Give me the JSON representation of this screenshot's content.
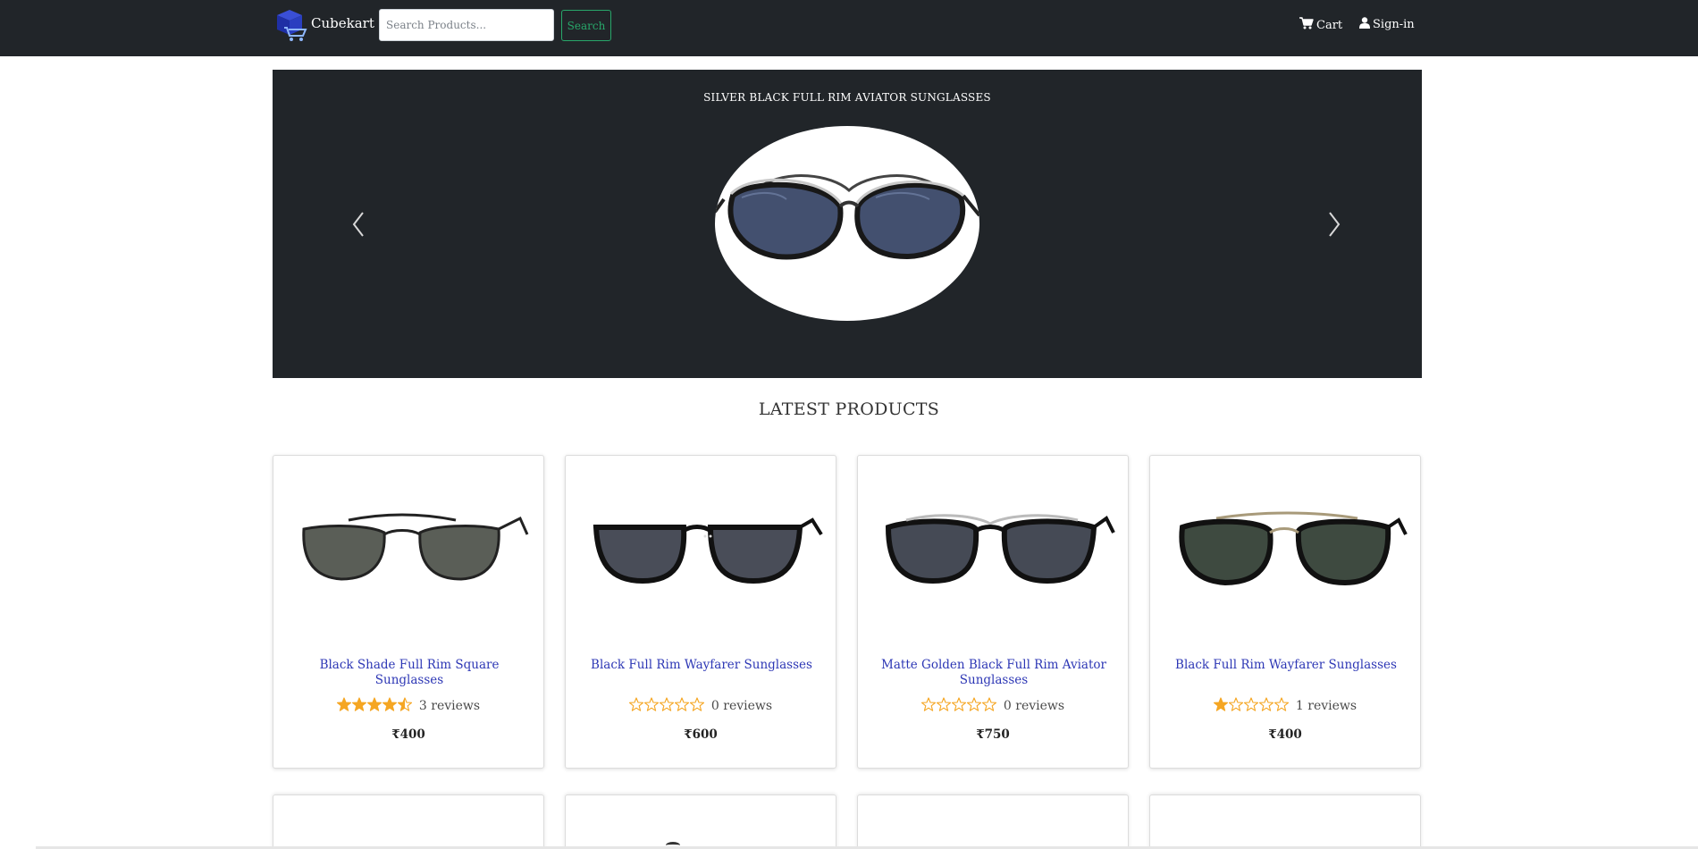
{
  "navbar": {
    "brand": "Cubekart",
    "brand_logo_icon": "cube-cart-logo-icon",
    "search_placeholder": "Search Products...",
    "search_value": "",
    "search_button": "Search",
    "links": [
      {
        "label": "Cart",
        "icon": "cart-icon"
      },
      {
        "label": "Sign-in",
        "icon": "user-icon"
      }
    ]
  },
  "carousel": {
    "caption": "SILVER BLACK FULL RIM AVIATOR SUNGLASSES",
    "prev_icon": "chevron-left-icon",
    "next_icon": "chevron-right-icon"
  },
  "section_title": "LATEST PRODUCTS",
  "products": [
    {
      "name": "Black Shade Full Rim Square Sunglasses",
      "rating": 4.5,
      "reviews": "3 reviews",
      "price": "₹400"
    },
    {
      "name": "Black Full Rim Wayfarer Sunglasses",
      "rating": 0,
      "reviews": "0 reviews",
      "price": "₹600"
    },
    {
      "name": "Matte Golden Black Full Rim Aviator Sunglasses",
      "rating": 0,
      "reviews": "0 reviews",
      "price": "₹750"
    },
    {
      "name": "Black Full Rim Wayfarer Sunglasses",
      "rating": 1,
      "reviews": "1 reviews",
      "price": "₹400"
    }
  ],
  "colors": {
    "navbar_bg": "#212529",
    "search_button": "#28a76a",
    "product_link": "#2d37b5",
    "star": "#f5a623"
  }
}
